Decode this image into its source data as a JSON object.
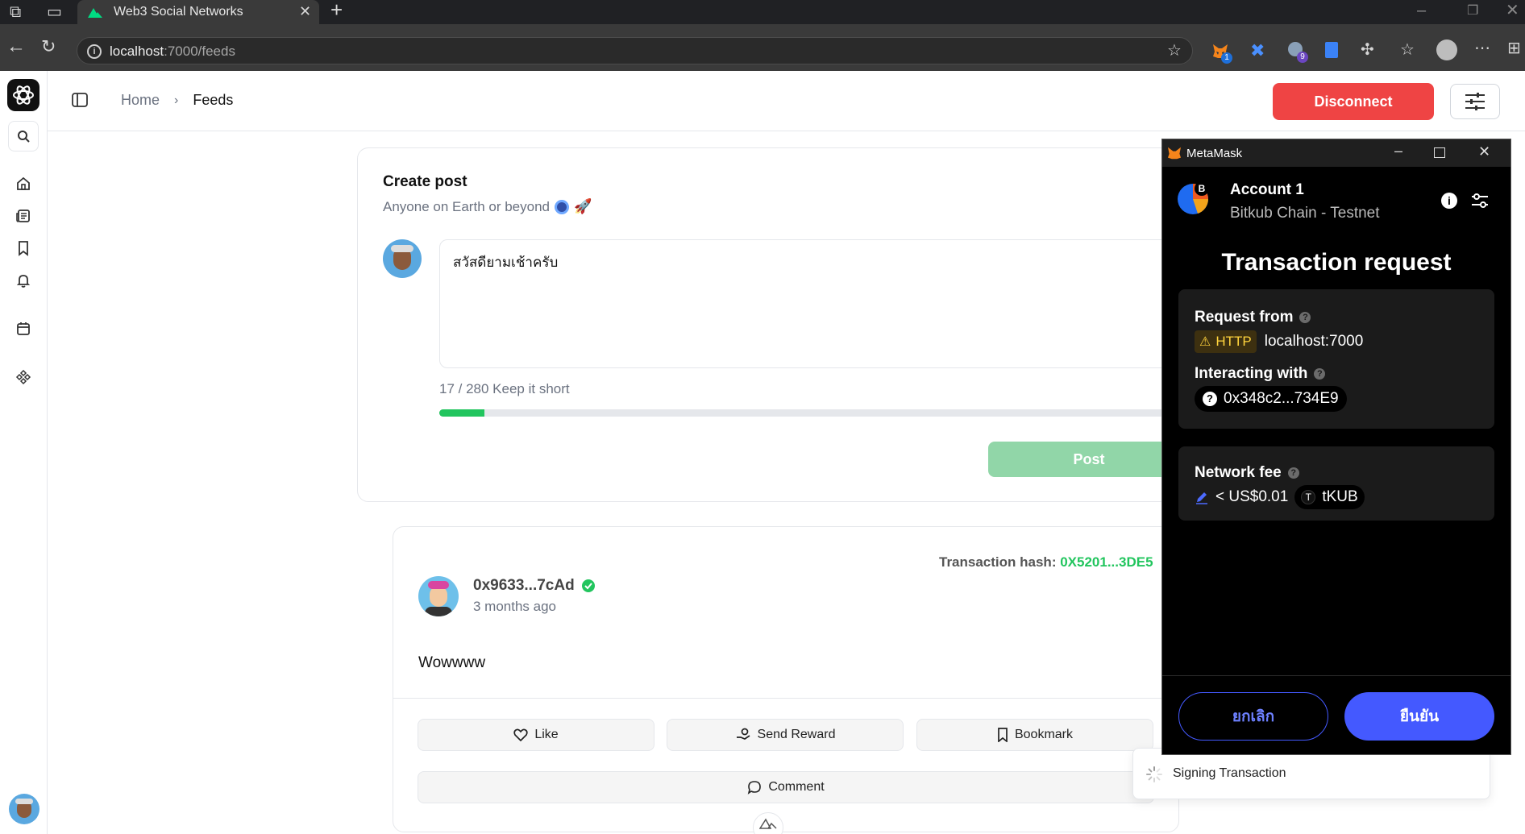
{
  "browser": {
    "tab_title": "Web3 Social Networks",
    "url_host": "localhost",
    "url_path": ":7000/feeds",
    "ext_badge_1": "1",
    "ext_badge_2": "9"
  },
  "app": {
    "breadcrumb": [
      "Home",
      "Feeds"
    ],
    "disconnect_label": "Disconnect"
  },
  "create_post": {
    "title": "Create post",
    "subtitle": "Anyone on Earth or beyond",
    "text": "สวัสดียามเช้าครับ",
    "counter": "17 / 280 Keep it short",
    "progress": 0.0607,
    "post_label": "Post"
  },
  "feed_post": {
    "tx_label": "Transaction hash:",
    "tx_hash": "0X5201...3DE5",
    "author": "0x9633...7cAd",
    "time": "3 months ago",
    "body": "Wowwww",
    "like_label": "Like",
    "reward_label": "Send Reward",
    "bookmark_label": "Bookmark",
    "comment_label": "Comment"
  },
  "metamask": {
    "window_title": "MetaMask",
    "account_name": "Account 1",
    "network": "Bitkub Chain - Testnet",
    "avatar_letter": "B",
    "heading": "Transaction request",
    "request_from_label": "Request from",
    "http_badge": "HTTP",
    "origin": "localhost:7000",
    "interacting_label": "Interacting with",
    "contract": "0x348c2...734E9",
    "fee_label": "Network fee",
    "fee_value": "< US$0.01",
    "token_letter": "T",
    "token": "tKUB",
    "cancel_label": "ยกเลิก",
    "confirm_label": "ยืนยัน"
  },
  "toast": {
    "text": "Signing Transaction"
  },
  "colors": {
    "danger": "#ef4444",
    "success": "#22c55e",
    "metamask_blue": "#4459ff"
  }
}
